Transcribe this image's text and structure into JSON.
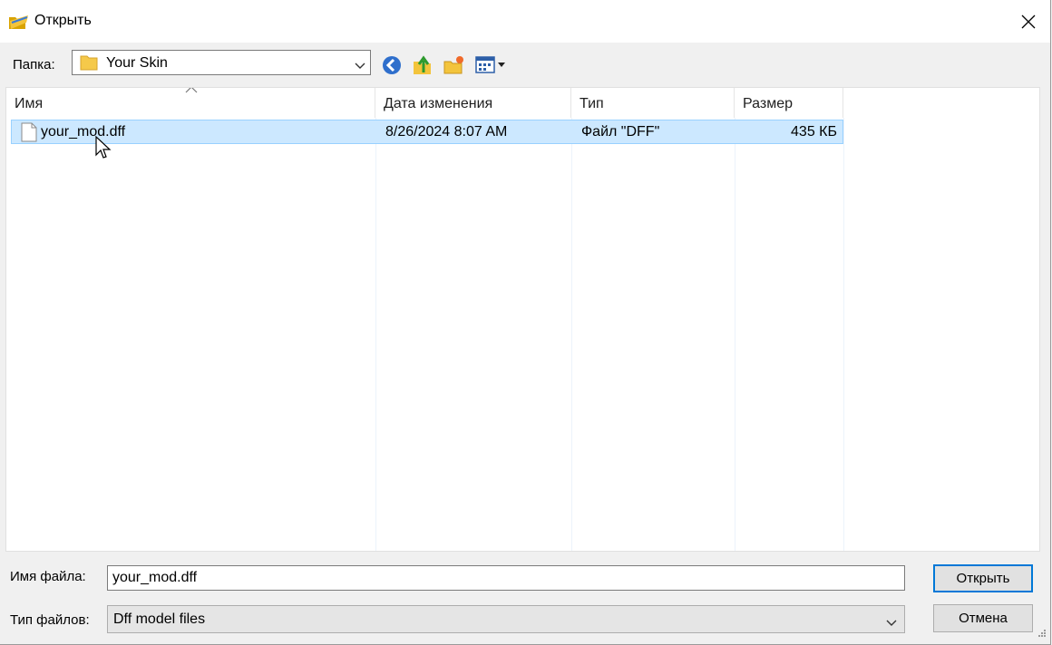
{
  "window": {
    "title": "Открыть"
  },
  "toolbar": {
    "folder_label": "Папка:",
    "folder_value": "Your Skin",
    "buttons": [
      "back-icon",
      "up-folder-icon",
      "new-folder-icon",
      "view-menu-icon"
    ]
  },
  "columns": [
    "Имя",
    "Дата изменения",
    "Тип",
    "Размер"
  ],
  "files": [
    {
      "name": "your_mod.dff",
      "modified": "8/26/2024 8:07 AM",
      "type": "Файл \"DFF\"",
      "size": "435 КБ"
    }
  ],
  "bottom": {
    "filename_label": "Имя файла:",
    "filename_value": "your_mod.dff",
    "filetype_label": "Тип файлов:",
    "filetype_value": "Dff model files",
    "open_label": "Открыть",
    "cancel_label": "Отмена"
  },
  "colors": {
    "selection": "#cce8ff",
    "selection_border": "#99d1ff",
    "accent": "#0078d7"
  }
}
